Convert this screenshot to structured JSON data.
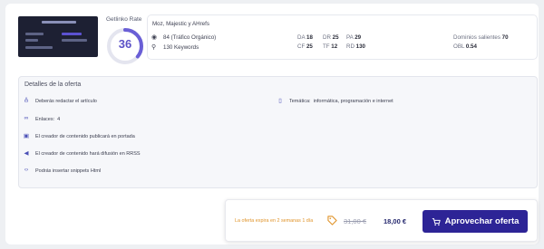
{
  "site": {
    "gauge_label": "Getlinko Rate",
    "rate": 36,
    "rate_fraction": 0.36,
    "metrics_source": "Moz, Majestic y AHrefs",
    "traffic": "84 (Tráfico Orgánico)",
    "keywords": "130 Keywords",
    "da_k": "DA",
    "da_v": "18",
    "dr_k": "DR",
    "dr_v": "25",
    "pa_k": "PA",
    "pa_v": "29",
    "cf_k": "CF",
    "cf_v": "25",
    "tf_k": "TF",
    "tf_v": "12",
    "rd_k": "RD",
    "rd_v": "130",
    "outgoing_k": "Dominios salientes",
    "outgoing_v": "70",
    "obl_k": "OBL",
    "obl_v": "0.54"
  },
  "offer": {
    "title": "Detalles de la oferta",
    "must_write": "Deberás redactar el artículo",
    "links_label": "Enlaces:",
    "links_value": "4",
    "homepage": "El creador de contenido publicará en portada",
    "social": "El creador de contenido hará difusión en RRSS",
    "html": "Podrás insertar snippets Html",
    "topic_label": "Temática:",
    "topic_value": "informática, programación e internet"
  },
  "cta": {
    "expires": "La oferta expira en 2 semanas 1 día",
    "old_price": "31,00 €",
    "new_price": "18,00 €",
    "button": "Aprovechar oferta"
  },
  "colors": {
    "accent": "#2d2496",
    "gauge": "#6a5fd6",
    "expire": "#e0942b"
  },
  "icons": [
    "eye-icon",
    "keywords-icon",
    "pen-icon",
    "link-icon",
    "homepage-icon",
    "megaphone-icon",
    "code-icon",
    "bookmark-icon",
    "tag-icon",
    "cart-icon"
  ]
}
